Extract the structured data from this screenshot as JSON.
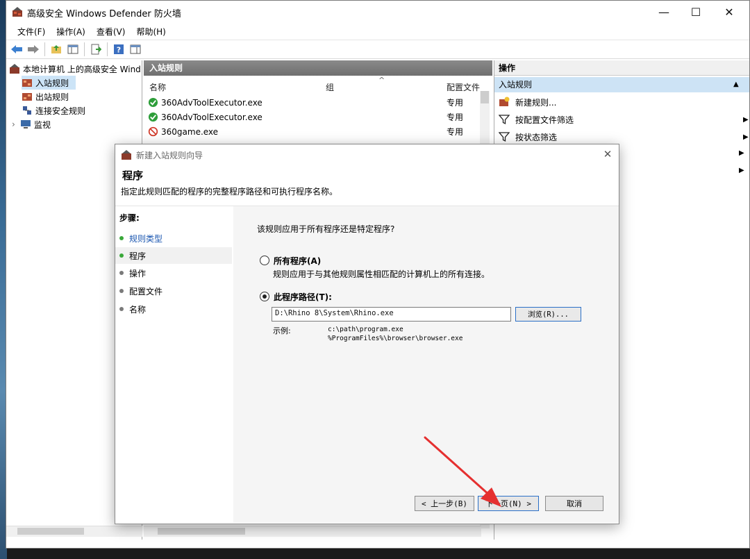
{
  "window": {
    "title": "高级安全 Windows Defender 防火墙",
    "min_glyph": "—",
    "max_glyph": "☐",
    "close_glyph": "✕"
  },
  "menu": [
    {
      "label": "文件(F)"
    },
    {
      "label": "操作(A)"
    },
    {
      "label": "查看(V)"
    },
    {
      "label": "帮助(H)"
    }
  ],
  "tree": {
    "root": "本地计算机 上的高级安全 Wind",
    "items": [
      {
        "label": "入站规则",
        "selected": true
      },
      {
        "label": "出站规则",
        "selected": false
      },
      {
        "label": "连接安全规则",
        "selected": false
      },
      {
        "label": "监视",
        "selected": false
      }
    ],
    "expander": "›"
  },
  "list": {
    "header": "入站规则",
    "columns": {
      "name": "名称",
      "group": "组",
      "profile": "配置文件"
    },
    "sort_glyph": "^",
    "rows": [
      {
        "name": "360AdvToolExecutor.exe",
        "profile": "专用",
        "status": "allow"
      },
      {
        "name": "360AdvToolExecutor.exe",
        "profile": "专用",
        "status": "allow"
      },
      {
        "name": "360game.exe",
        "profile": "专用",
        "status": "block"
      }
    ]
  },
  "actions": {
    "header": "操作",
    "section": "入站规则",
    "section_glyph": "▲",
    "items": [
      {
        "label": "新建规则...",
        "has_arrow": false
      },
      {
        "label": "按配置文件筛选",
        "has_arrow": true
      },
      {
        "label": "按状态筛选",
        "has_arrow": true
      }
    ],
    "arrow_glyph": "▶"
  },
  "wizard": {
    "title": "新建入站规则向导",
    "close_glyph": "✕",
    "heading": "程序",
    "subheading": "指定此规则匹配的程序的完整程序路径和可执行程序名称。",
    "steps_title": "步骤:",
    "steps": [
      {
        "label": "规则类型",
        "state": "done"
      },
      {
        "label": "程序",
        "state": "current"
      },
      {
        "label": "操作",
        "state": "pending"
      },
      {
        "label": "配置文件",
        "state": "pending"
      },
      {
        "label": "名称",
        "state": "pending"
      }
    ],
    "question": "该规则应用于所有程序还是特定程序?",
    "option_all": {
      "label": "所有程序(A)",
      "desc": "规则应用于与其他规则属性相匹配的计算机上的所有连接。",
      "checked": false
    },
    "option_path": {
      "label": "此程序路径(T):",
      "checked": true
    },
    "path_value": "D:\\Rhino 8\\System\\Rhino.exe",
    "browse_label": "浏览(R)...",
    "example_label": "示例:",
    "example_1": "c:\\path\\program.exe",
    "example_2": "%ProgramFiles%\\browser\\browser.exe",
    "back_label": "< 上一步(B)",
    "next_label": "下一页(N) >",
    "cancel_label": "取消"
  },
  "colors": {
    "accent": "#2a6fc7",
    "step_done": "#3aa83a",
    "step_pending": "#7a7a7a",
    "arrow": "#e53030"
  }
}
